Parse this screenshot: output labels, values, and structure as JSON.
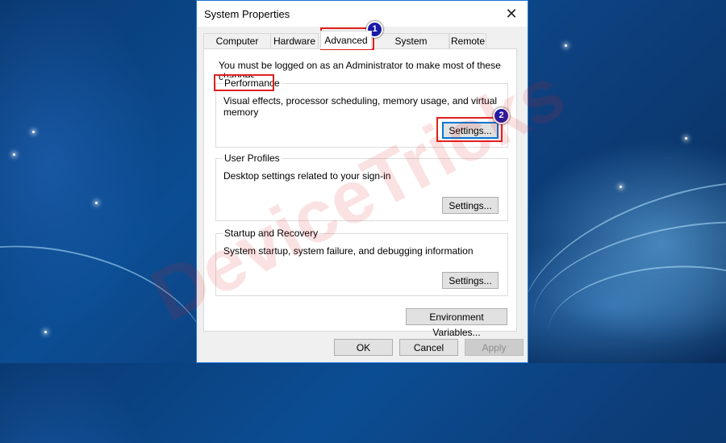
{
  "window": {
    "title": "System Properties",
    "close_glyph": "✕"
  },
  "tabs": [
    {
      "label": "Computer Name",
      "active": false
    },
    {
      "label": "Hardware",
      "active": false
    },
    {
      "label": "Advanced",
      "active": true
    },
    {
      "label": "System Protection",
      "active": false
    },
    {
      "label": "Remote",
      "active": false
    }
  ],
  "panel": {
    "note": "You must be logged on as an Administrator to make most of these changes.",
    "performance": {
      "title": "Performance",
      "description": "Visual effects, processor scheduling, memory usage, and virtual memory",
      "button": "Settings..."
    },
    "user_profiles": {
      "title": "User Profiles",
      "description": "Desktop settings related to your sign-in",
      "button": "Settings..."
    },
    "startup_recovery": {
      "title": "Startup and Recovery",
      "description": "System startup, system failure, and debugging information",
      "button": "Settings..."
    },
    "env_button": "Environment Variables..."
  },
  "footer": {
    "ok": "OK",
    "cancel": "Cancel",
    "apply": "Apply"
  },
  "annotations": {
    "badge1": "1",
    "badge2": "2"
  },
  "watermark": "DeviceTricks",
  "colors": {
    "highlight": "#e02020",
    "badge": "#1a1aa8",
    "focus": "#0078d7"
  }
}
